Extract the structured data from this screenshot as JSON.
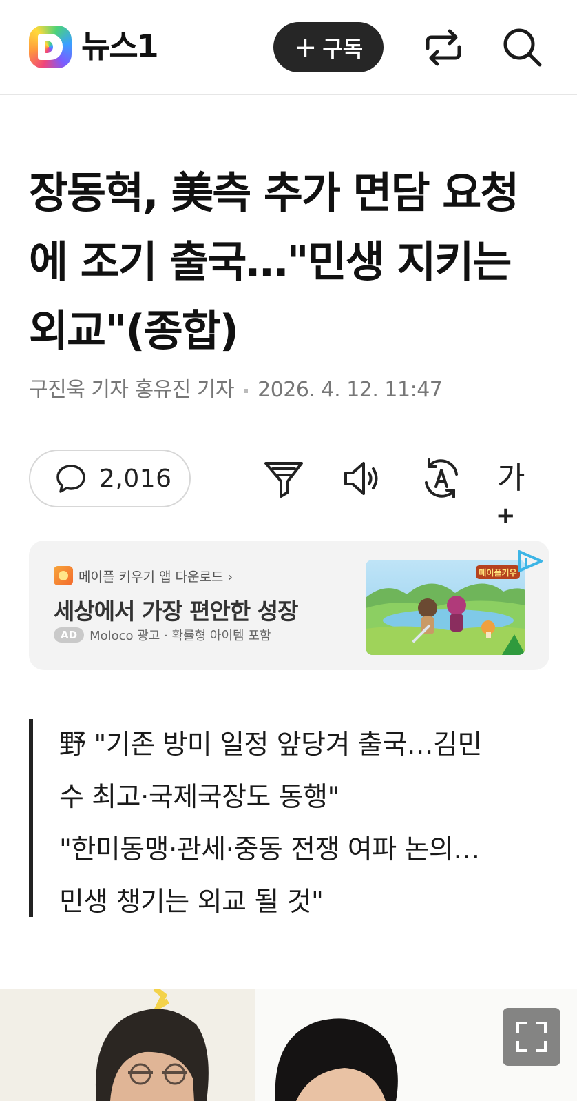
{
  "header": {
    "brand": "뉴스1",
    "logo_letter": "D",
    "subscribe_label": "구독",
    "icons": [
      "share-icon",
      "search-icon"
    ]
  },
  "article": {
    "title_lines": [
      "장동혁, 美측 추가 면담 요청",
      "에 조기 출국…\"민생 지키는",
      "외교\"(종합)"
    ],
    "reporters": "구진욱 기자 홍유진 기자",
    "datetime": "2026. 4. 12. 11:47",
    "comment_count": "2,016",
    "font_tool_label": "가",
    "summary_lines": [
      "野 \"기존 방미 일정 앞당겨 출국…김민",
      "수 최고·국제국장도 동행\"",
      "\"한미동맹·관세·중동 전쟁 여파 논의…",
      "민생 챙기는 외교 될 것\""
    ]
  },
  "ad": {
    "app_line": "메이플 키우기 앱 다운로드 ›",
    "headline": "세상에서 가장 편안한 성장",
    "badge": "AD",
    "meta": "Moloco 광고 · 확률형 아이템 포함",
    "image_logo_text": "메이플키우"
  },
  "colors": {
    "subscribe_bg": "#262626",
    "quote_bar": "#222222",
    "ad_bg": "#f3f3f3"
  }
}
